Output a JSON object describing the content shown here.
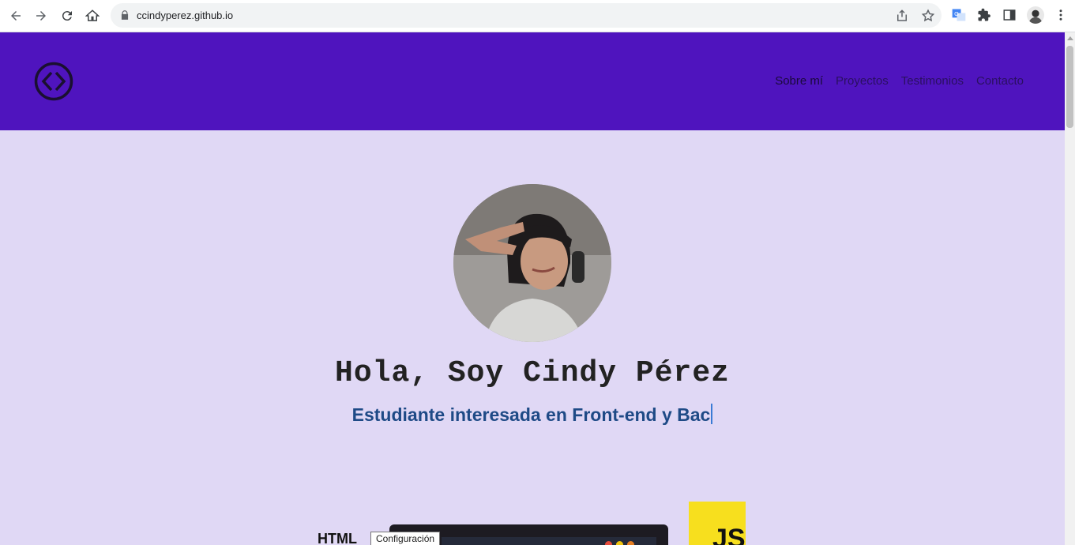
{
  "browser": {
    "url": "ccindyperez.github.io",
    "icons": [
      "back-icon",
      "forward-icon",
      "reload-icon",
      "home-icon",
      "lock-icon",
      "share-icon",
      "star-icon",
      "translate-icon",
      "extensions-icon",
      "side-panel-icon",
      "profile-avatar",
      "menu-icon"
    ]
  },
  "site": {
    "nav": [
      {
        "label": "Sobre mí"
      },
      {
        "label": "Proyectos"
      },
      {
        "label": "Testimonios"
      },
      {
        "label": "Contacto"
      }
    ],
    "hero": {
      "title": "Hola, Soy Cindy Pérez",
      "subtitle": "Estudiante interesada en Front-end y Bac"
    },
    "skills": {
      "html_label": "HTML",
      "js_label": "JS"
    },
    "tooltip": "Configuración"
  },
  "colors": {
    "header": "#4f14be",
    "page_bg": "#e0d8f5",
    "subtitle": "#1e4a86",
    "js_yellow": "#f7df1e"
  }
}
